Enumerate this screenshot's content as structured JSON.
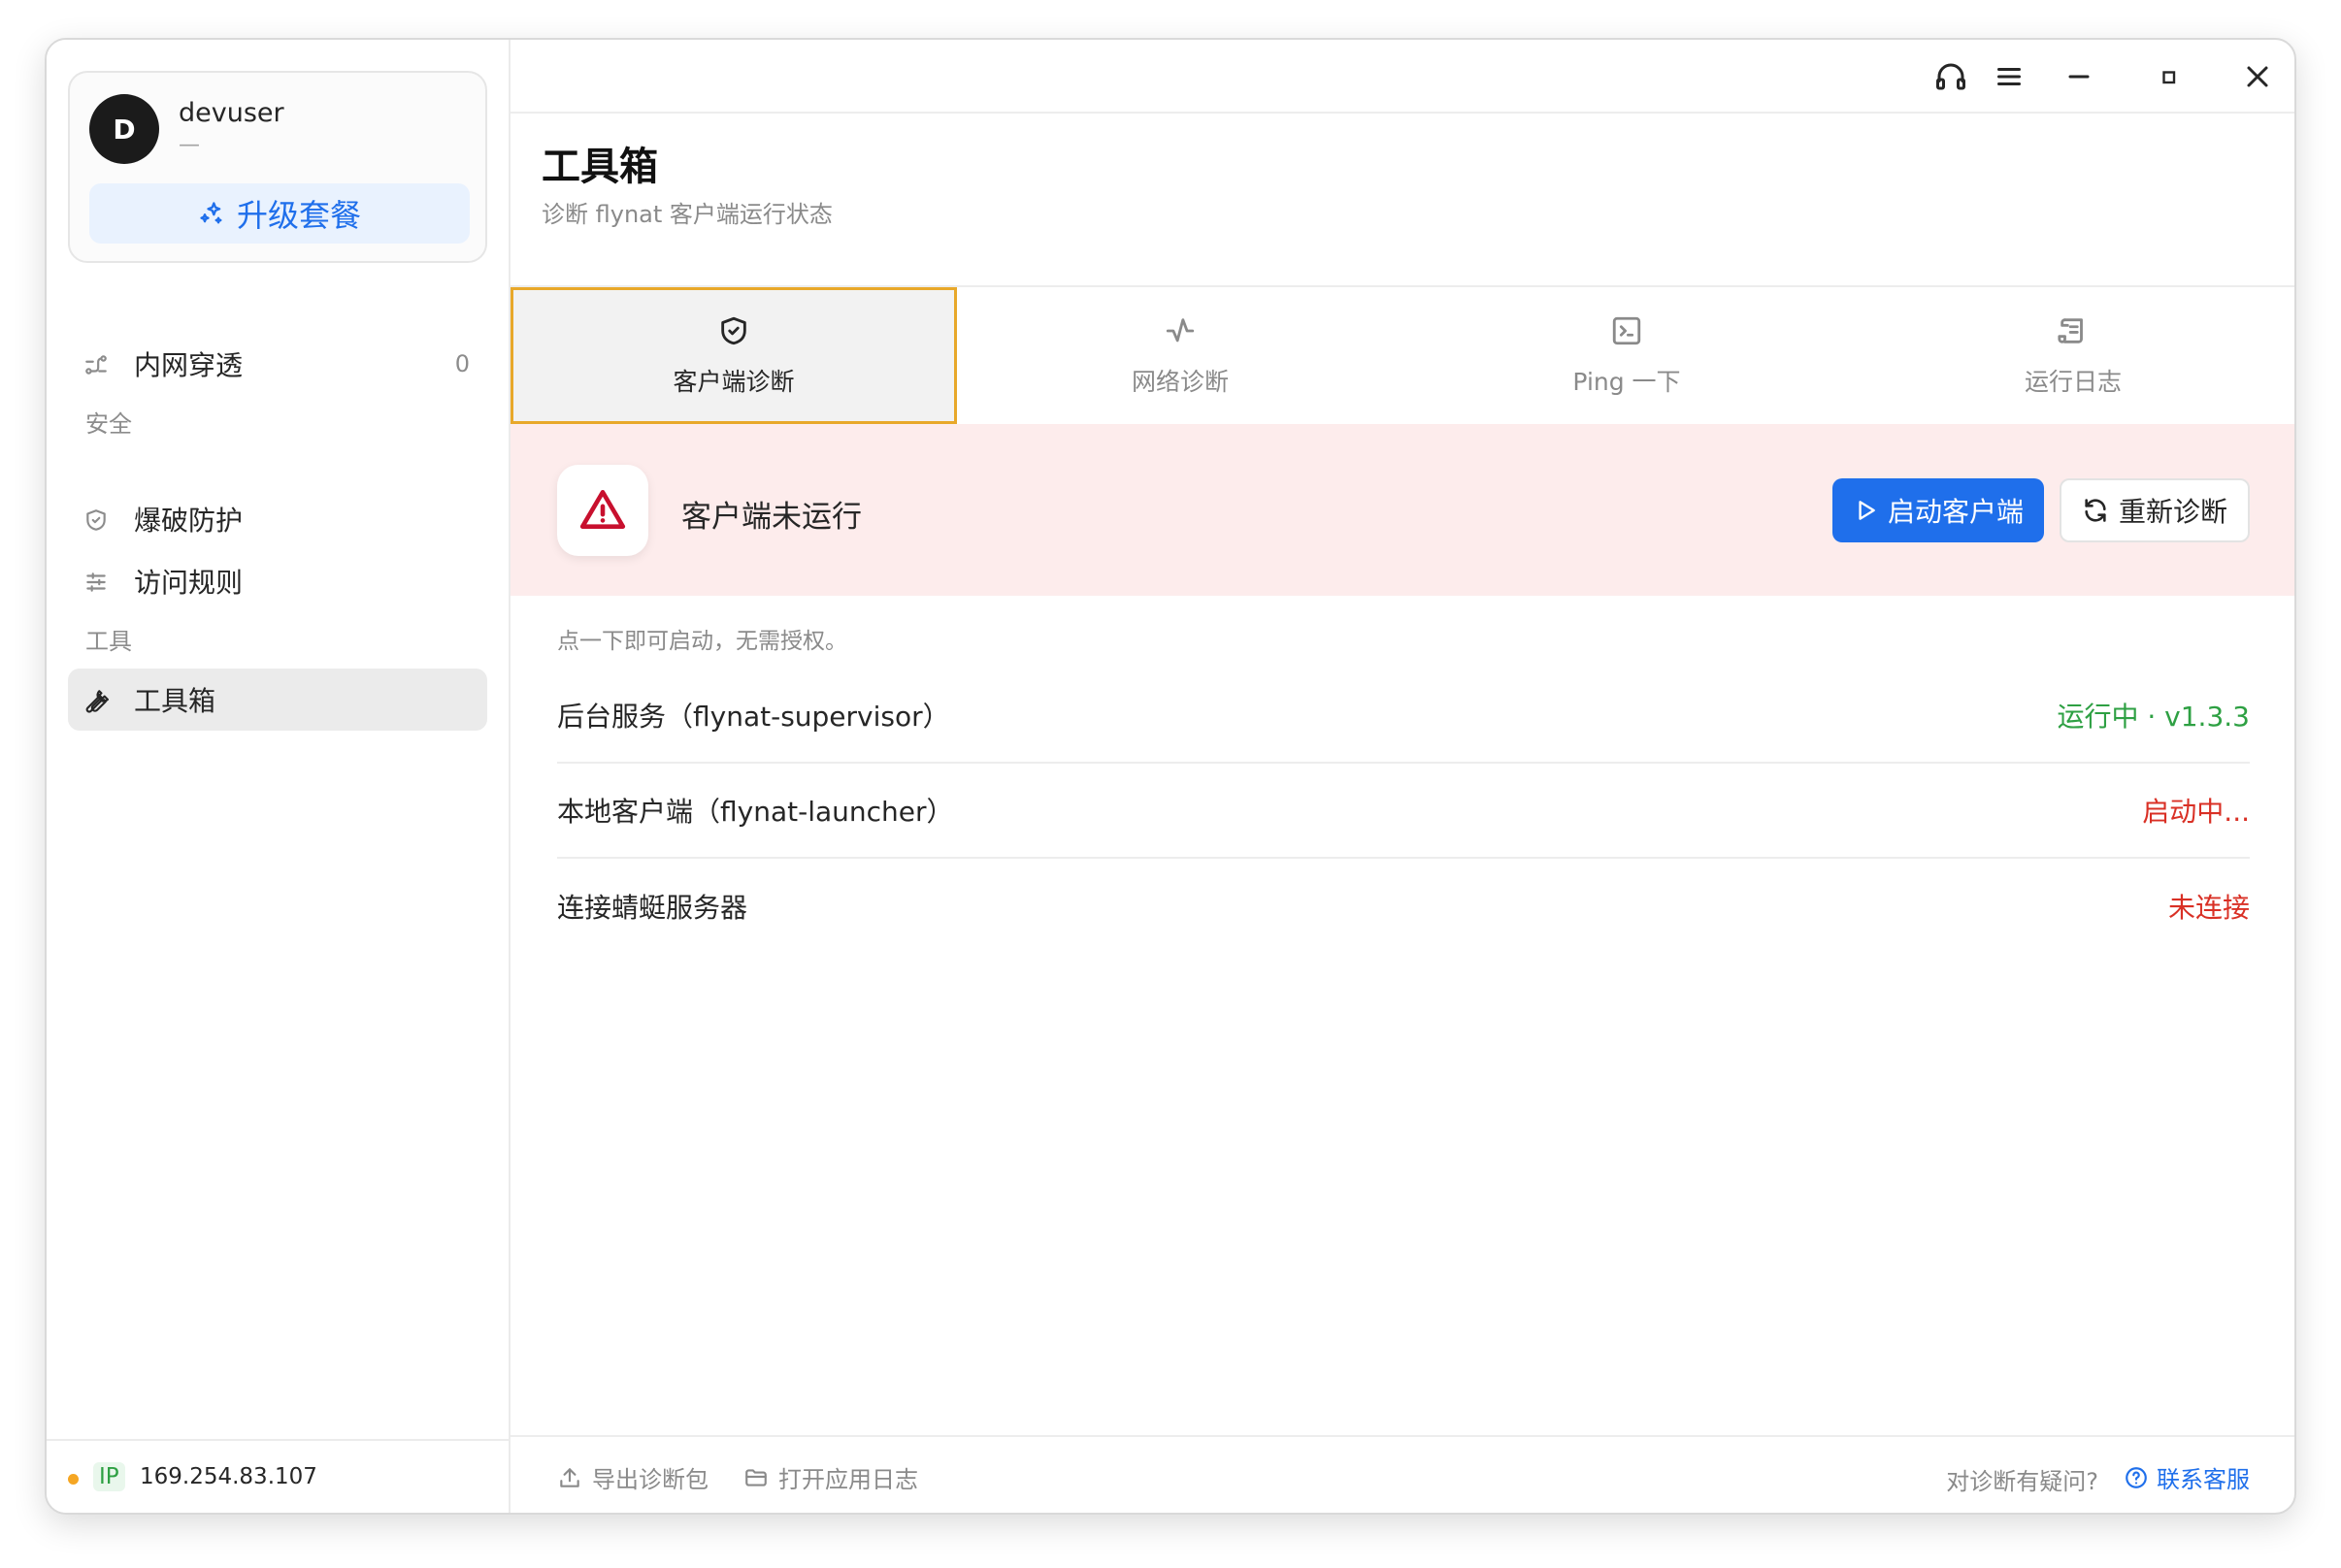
{
  "user": {
    "avatar_letter": "D",
    "name": "devuser",
    "sub": "—",
    "upgrade_label": "升级套餐"
  },
  "sidebar": {
    "nav_tunnel": {
      "label": "内网穿透",
      "count": "0"
    },
    "section_security": "安全",
    "security_items": [
      {
        "label": "爆破防护"
      },
      {
        "label": "访问规则"
      }
    ],
    "section_tools": "工具",
    "tools_items": [
      {
        "label": "工具箱"
      }
    ],
    "footer": {
      "ip_label": "IP",
      "ip_value": "169.254.83.107"
    }
  },
  "header": {
    "title": "工具箱",
    "subtitle": "诊断 flynat 客户端运行状态"
  },
  "tabs": [
    {
      "label": "客户端诊断"
    },
    {
      "label": "网络诊断"
    },
    {
      "label": "Ping 一下"
    },
    {
      "label": "运行日志"
    }
  ],
  "alert": {
    "message": "客户端未运行",
    "start_label": "启动客户端",
    "rediagnose_label": "重新诊断"
  },
  "hint": "点一下即可启动，无需授权。",
  "services": [
    {
      "name": "后台服务（flynat-supervisor）",
      "status": "运行中 · v1.3.3"
    },
    {
      "name": "本地客户端（flynat-launcher）",
      "status": "启动中..."
    },
    {
      "name": "连接蜻蜓服务器",
      "status": "未连接"
    }
  ],
  "footer": {
    "export_label": "导出诊断包",
    "open_log_label": "打开应用日志",
    "question": "对诊断有疑问?",
    "support_label": "联系客服"
  },
  "colors": {
    "accent": "#1f6feb",
    "alert_bg": "#fdecec",
    "alert_icon": "#c8102e",
    "ok": "#2ea043",
    "error": "#d93025",
    "tab_active_border": "#e8a82a",
    "status_dot": "#f5a623"
  }
}
